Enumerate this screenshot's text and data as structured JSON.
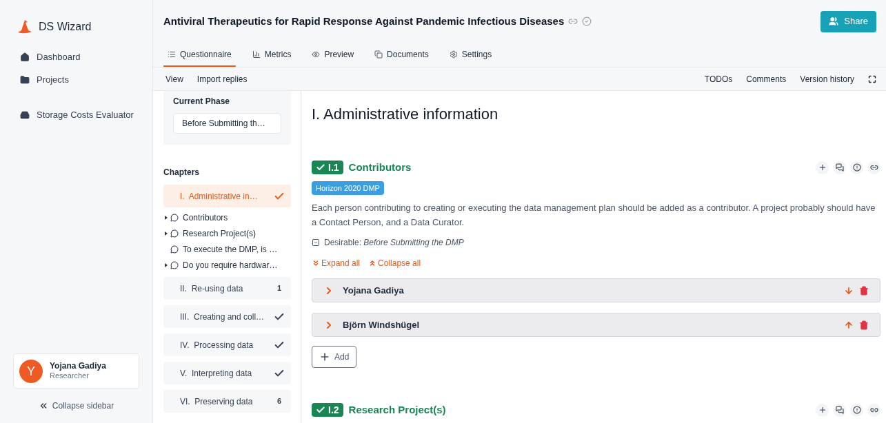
{
  "app": {
    "name": "DS Wizard"
  },
  "nav_groups": [
    {
      "items": [
        {
          "label": "Dashboard",
          "kind": "home"
        },
        {
          "label": "Projects",
          "kind": "folder"
        }
      ]
    },
    {
      "items": [
        {
          "label": "Storage Costs Evaluator",
          "kind": "drive"
        }
      ]
    }
  ],
  "user": {
    "initial": "Y",
    "name": "Yojana Gadiya",
    "role": "Researcher"
  },
  "collapse": "Collapse sidebar",
  "project": {
    "title": "Antiviral Therapeutics for Rapid Response Against Pandemic Infectious Diseases",
    "share": "Share"
  },
  "tabs": [
    {
      "label": "Questionnaire",
      "kind": "list",
      "selected": true
    },
    {
      "label": "Metrics",
      "kind": "chart",
      "selected": false
    },
    {
      "label": "Preview",
      "kind": "eye",
      "selected": false
    },
    {
      "label": "Documents",
      "kind": "copy",
      "selected": false
    },
    {
      "label": "Settings",
      "kind": "cogs",
      "selected": false
    }
  ],
  "toolbar": {
    "left": [
      "View",
      "Import replies"
    ],
    "right": [
      "TODOs",
      "Comments",
      "Version history"
    ]
  },
  "phase": {
    "label": "Current Phase",
    "value": "Before Submitting th…"
  },
  "chapters_heading": "Chapters",
  "chapters": [
    {
      "label": "I.  Administrative in…",
      "selected": true,
      "kind": "done",
      "questions": [
        {
          "label": "Contributors",
          "expandable": true
        },
        {
          "label": "Research Project(s)",
          "expandable": true
        },
        {
          "label": "To execute the DMP, is …",
          "expandable": false
        },
        {
          "label": "Do you require hardwar…",
          "expandable": true
        }
      ]
    },
    {
      "label": "II.  Re-using data",
      "selected": false,
      "kind": "count",
      "count": "1"
    },
    {
      "label": "III.  Creating and coll…",
      "selected": false,
      "kind": "done"
    },
    {
      "label": "IV.  Processing data",
      "selected": false,
      "kind": "done"
    },
    {
      "label": "V.  Interpreting data",
      "selected": false,
      "kind": "done"
    },
    {
      "label": "VI.  Preserving data",
      "selected": false,
      "kind": "count",
      "count": "6"
    }
  ],
  "content": {
    "title": "I. Administrative information",
    "questions": [
      {
        "number": "I.1",
        "title": "Contributors",
        "answered": true,
        "tags": [
          "Horizon 2020 DMP"
        ],
        "text": "Each person contributing to creating or executing the data management plan should be added as a contributor. A project probably should have a Contact Person, and a Data Curator.",
        "desirable": "Desirable: *Before Submitting the DMP*",
        "expand": "Expand all",
        "collapse": "Collapse all",
        "items": [
          {
            "name": "Yojana Gadiya",
            "kind": "down"
          },
          {
            "name": "Björn Windshügel",
            "kind": "up"
          }
        ],
        "add": "Add"
      },
      {
        "number": "I.2",
        "title": "Research Project(s)",
        "answered": true
      }
    ]
  }
}
